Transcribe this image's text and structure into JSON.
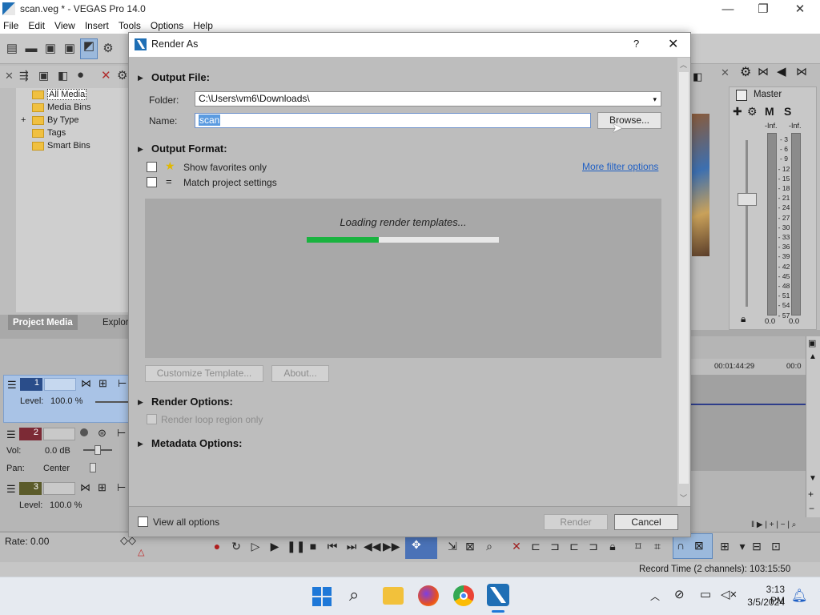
{
  "window": {
    "title": "scan.veg * - VEGAS Pro 14.0",
    "controls": [
      "—",
      "❐",
      "✕"
    ]
  },
  "menu": [
    "File",
    "Edit",
    "View",
    "Insert",
    "Tools",
    "Options",
    "Help"
  ],
  "explorer": {
    "tree": [
      {
        "label": "All Media",
        "selected": true,
        "expand": ""
      },
      {
        "label": "Media Bins",
        "selected": false,
        "expand": ""
      },
      {
        "label": "By Type",
        "selected": false,
        "expand": "+"
      },
      {
        "label": "Tags",
        "selected": false,
        "expand": ""
      },
      {
        "label": "Smart Bins",
        "selected": false,
        "expand": ""
      }
    ],
    "tabs": [
      "Project Media",
      "Explor"
    ]
  },
  "mixer": {
    "label": "Master",
    "m_label": "M",
    "s_label": "S",
    "inf_left": "-Inf.",
    "inf_right": "-Inf.",
    "scale": [
      "3",
      "6",
      "9",
      "12",
      "15",
      "18",
      "21",
      "24",
      "27",
      "30",
      "33",
      "36",
      "39",
      "42",
      "45",
      "48",
      "51",
      "54",
      "57"
    ],
    "bottom_left": "0.0",
    "bottom_right": "0.0"
  },
  "timeline": {
    "time_partial": "00",
    "ruler": [
      "00:01:44:29",
      "00:0"
    ],
    "tracks": [
      {
        "number": "1",
        "line1_label": "Level:",
        "line1_value": "100.0 %"
      },
      {
        "number": "2",
        "line1_label": "Vol:",
        "line1_value": "0.0 dB",
        "line2_label": "Pan:",
        "line2_value": "Center"
      },
      {
        "number": "3",
        "line1_label": "Level:",
        "line1_value": "100.0 %"
      }
    ]
  },
  "transport": {
    "rate": "Rate: 0.00"
  },
  "status": {
    "record_time": "Record Time (2 channels): 103:15:50"
  },
  "taskbar": {
    "time": "3:13 PM",
    "date": "3/5/2024"
  },
  "dialog": {
    "title": "Render As",
    "help": "?",
    "close": "✕",
    "output_file": {
      "heading": "Output File:",
      "folder_label": "Folder:",
      "folder_value": "C:\\Users\\vm6\\Downloads\\",
      "name_label": "Name:",
      "name_value": "scan",
      "browse": "Browse..."
    },
    "output_format": {
      "heading": "Output Format:",
      "show_favorites": "Show favorites only",
      "match_project": "Match project settings",
      "more_filter": "More filter options",
      "loading_text": "Loading render templates...",
      "progress_fraction": 0.375,
      "customize": "Customize Template...",
      "about": "About..."
    },
    "render_options": {
      "heading": "Render Options:",
      "loop_region": "Render loop region only"
    },
    "metadata_options": {
      "heading": "Metadata Options:"
    },
    "footer": {
      "view_all": "View all options",
      "render": "Render",
      "cancel": "Cancel"
    }
  }
}
